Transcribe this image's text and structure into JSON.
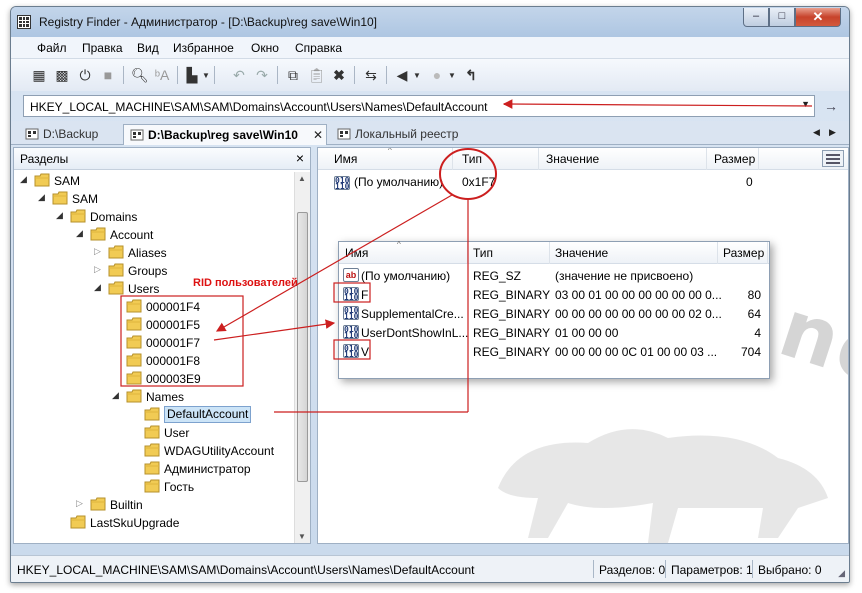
{
  "window": {
    "title": "Registry Finder - Администратор - [D:\\Backup\\reg save\\Win10]",
    "min_glyph": "–",
    "max_glyph": "□",
    "close_glyph": "✕"
  },
  "menu": [
    "Файл",
    "Правка",
    "Вид",
    "Избранное",
    "Окно",
    "Справка"
  ],
  "toolbar": {
    "icons": [
      "grid-icon",
      "network-grid-icon",
      "power-grid-icon",
      "save-icon",
      "search-icon",
      "find-replace-icon",
      "export-icon",
      "undo-icon",
      "redo-icon",
      "copy-icon",
      "paste-icon",
      "delete-icon",
      "refresh-icon",
      "back-icon",
      "forward-icon",
      "up-icon"
    ]
  },
  "address": {
    "value": "HKEY_LOCAL_MACHINE\\SAM\\SAM\\Domains\\Account\\Users\\Names\\DefaultAccount"
  },
  "tabs": [
    {
      "label": "D:\\Backup",
      "active": false
    },
    {
      "label": "D:\\Backup\\reg save\\Win10",
      "active": true
    },
    {
      "label": "Локальный реестр",
      "active": false
    }
  ],
  "left_panel": {
    "title": "Разделы",
    "tree": [
      {
        "label": "SAM",
        "level": 0,
        "expanded": true
      },
      {
        "label": "SAM",
        "level": 1,
        "expanded": true
      },
      {
        "label": "Domains",
        "level": 2,
        "expanded": true
      },
      {
        "label": "Account",
        "level": 3,
        "expanded": true
      },
      {
        "label": "Aliases",
        "level": 4,
        "expanded": false
      },
      {
        "label": "Groups",
        "level": 4,
        "expanded": false
      },
      {
        "label": "Users",
        "level": 4,
        "expanded": true
      },
      {
        "label": "000001F4",
        "level": 5,
        "expanded": null
      },
      {
        "label": "000001F5",
        "level": 5,
        "expanded": null
      },
      {
        "label": "000001F7",
        "level": 5,
        "expanded": null
      },
      {
        "label": "000001F8",
        "level": 5,
        "expanded": null
      },
      {
        "label": "000003E9",
        "level": 5,
        "expanded": null
      },
      {
        "label": "Names",
        "level": 5,
        "expanded": true
      },
      {
        "label": "DefaultAccount",
        "level": 6,
        "expanded": null,
        "selected": true
      },
      {
        "label": "User",
        "level": 6,
        "expanded": null
      },
      {
        "label": "WDAGUtilityAccount",
        "level": 6,
        "expanded": null
      },
      {
        "label": "Администратор",
        "level": 6,
        "expanded": null
      },
      {
        "label": "Гость",
        "level": 6,
        "expanded": null
      },
      {
        "label": "Builtin",
        "level": 3,
        "expanded": false
      },
      {
        "label": "LastSkuUpgrade",
        "level": 2,
        "expanded": null
      }
    ]
  },
  "values_list": {
    "columns": [
      "Имя",
      "Тип",
      "Значение",
      "Размер"
    ],
    "rows": [
      {
        "name": "(По умолчанию)",
        "type": "0x1F7",
        "value": "",
        "size": "0",
        "icon": "binary-value-icon"
      }
    ]
  },
  "popup_list": {
    "columns": [
      "Имя",
      "Тип",
      "Значение",
      "Размер"
    ],
    "rows": [
      {
        "name": "(По умолчанию)",
        "type": "REG_SZ",
        "value": "(значение не присвоено)",
        "size": "",
        "icon": "ab"
      },
      {
        "name": "F",
        "type": "REG_BINARY",
        "value": "03 00 01 00 00 00 00 00 00 0...",
        "size": "80",
        "icon": "bin"
      },
      {
        "name": "SupplementalCre...",
        "type": "REG_BINARY",
        "value": "00 00 00 00 00 00 00 00 02 0...",
        "size": "64",
        "icon": "bin"
      },
      {
        "name": "UserDontShowInL...",
        "type": "REG_BINARY",
        "value": "01 00 00 00",
        "size": "4",
        "icon": "bin"
      },
      {
        "name": "V",
        "type": "REG_BINARY",
        "value": "00 00 00 00 0C 01 00 00 03 ...",
        "size": "704",
        "icon": "bin"
      }
    ]
  },
  "annotation": {
    "rid_label": "RID пользователей",
    "color": "#cc1f1f"
  },
  "status": {
    "path": "HKEY_LOCAL_MACHINE\\SAM\\SAM\\Domains\\Account\\Users\\Names\\DefaultAccount",
    "sections": "Разделов: 0",
    "params": "Параметров: 1",
    "selected": "Выбрано: 0"
  }
}
